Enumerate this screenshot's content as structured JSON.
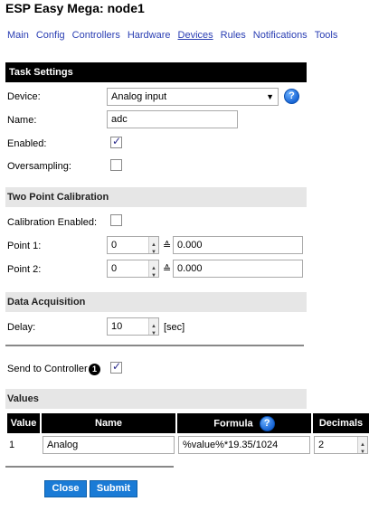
{
  "app": {
    "title": "ESP Easy Mega: node1"
  },
  "menu": [
    {
      "label": "Main"
    },
    {
      "label": "Config"
    },
    {
      "label": "Controllers"
    },
    {
      "label": "Hardware"
    },
    {
      "label": "Devices",
      "active": true
    },
    {
      "label": "Rules"
    },
    {
      "label": "Notifications"
    },
    {
      "label": "Tools"
    }
  ],
  "task_settings": {
    "header": "Task Settings",
    "device_label": "Device:",
    "device_value": "Analog input",
    "name_label": "Name:",
    "name_value": "adc",
    "enabled_label": "Enabled:",
    "enabled": true,
    "oversampling_label": "Oversampling:",
    "oversampling": false
  },
  "calibration": {
    "header": "Two Point Calibration",
    "enabled_label": "Calibration Enabled:",
    "enabled": false,
    "point1_label": "Point 1:",
    "point1_raw": "0",
    "point1_value": "0.000",
    "point2_label": "Point 2:",
    "point2_raw": "0",
    "point2_value": "0.000",
    "arrow_symbol": "≙"
  },
  "acquisition": {
    "header": "Data Acquisition",
    "delay_label": "Delay:",
    "delay_value": "10",
    "delay_unit": "[sec]",
    "send_label": "Send to Controller",
    "controller_number": "1",
    "send_enabled": true
  },
  "values": {
    "header": "Values",
    "columns": [
      "Value",
      "Name",
      "Formula",
      "Decimals"
    ],
    "rows": [
      {
        "value": "1",
        "name": "Analog",
        "formula": "%value%*19.35/1024",
        "decimals": "2"
      }
    ]
  },
  "buttons": {
    "close": "Close",
    "submit": "Submit"
  },
  "colors": {
    "accent": "#1a7bd6",
    "link": "#2a3eb3",
    "header_dark": "#000000",
    "header_light": "#e6e6e6"
  }
}
